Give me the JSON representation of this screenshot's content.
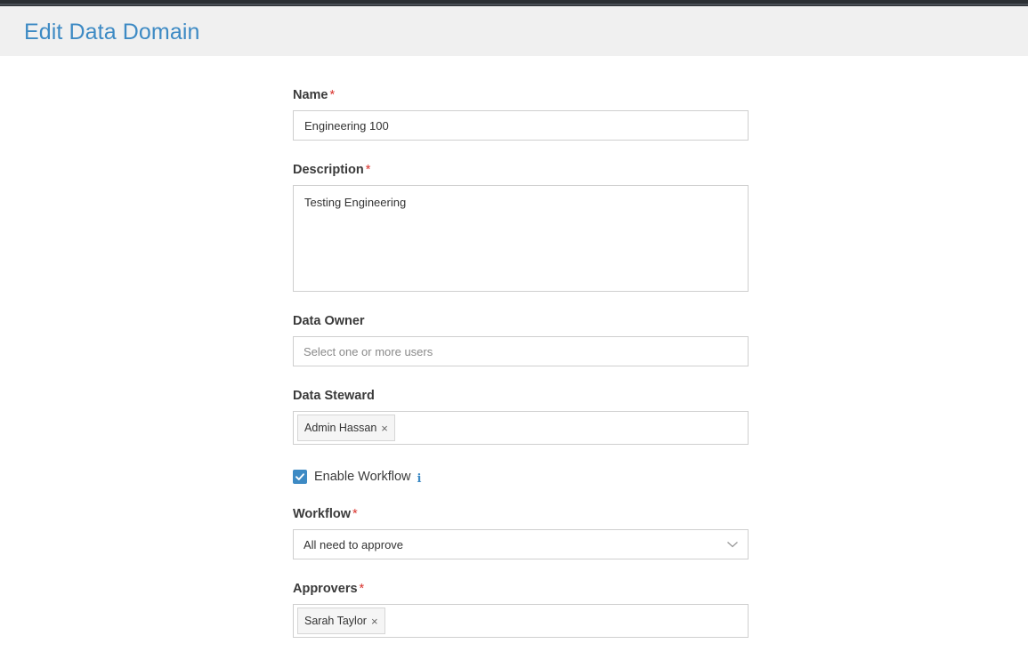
{
  "page": {
    "title": "Edit Data Domain"
  },
  "form": {
    "name": {
      "label": "Name",
      "required_mark": "*",
      "value": "Engineering 100"
    },
    "description": {
      "label": "Description",
      "required_mark": "*",
      "value": "Testing Engineering"
    },
    "data_owner": {
      "label": "Data Owner",
      "placeholder": "Select one or more users"
    },
    "data_steward": {
      "label": "Data Steward",
      "tags": [
        "Admin Hassan"
      ],
      "remove_glyph": "×"
    },
    "enable_workflow": {
      "label": "Enable Workflow",
      "checked": true,
      "info_glyph": "i"
    },
    "workflow": {
      "label": "Workflow",
      "required_mark": "*",
      "selected": "All need to approve"
    },
    "approvers": {
      "label": "Approvers",
      "required_mark": "*",
      "tags": [
        "Sarah Taylor"
      ],
      "remove_glyph": "×"
    }
  },
  "colors": {
    "accent": "#3d8ac4",
    "required": "#d9322c",
    "header_bg": "#f0f0f0",
    "topbar": "#2b2f33"
  },
  "icons": {
    "checkbox": "check-icon",
    "info": "info-icon",
    "dropdown": "chevron-down-icon",
    "remove_tag": "close-icon"
  }
}
